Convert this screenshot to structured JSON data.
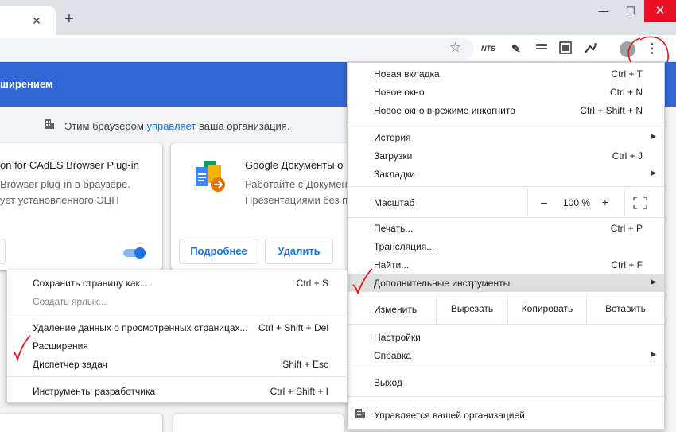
{
  "window": {
    "tab_close": "✕",
    "new_tab": "+",
    "minimize": "—",
    "maximize": "☐",
    "close": "✕"
  },
  "toolbar": {
    "ext_nts": "NTS"
  },
  "page": {
    "header_title": "ширением",
    "managed_prefix": "Этим браузером ",
    "managed_link": "управляет",
    "managed_suffix": " ваша организация.",
    "card1": {
      "title": "on for CAdES Browser Plug-in",
      "description": "Browser plug-in в браузере.\nует установленного ЭЦП",
      "toggle_enabled": true
    },
    "card2": {
      "title": "Google Документы о",
      "description": "Работайте с Докумен\nПрезентациями без п",
      "details_button": "Подробнее",
      "remove_button": "Удалить"
    }
  },
  "menu": {
    "new_tab": {
      "label": "Новая вкладка",
      "shortcut": "Ctrl + T"
    },
    "new_window": {
      "label": "Новое окно",
      "shortcut": "Ctrl + N"
    },
    "incognito": {
      "label": "Новое окно в режиме инкогнито",
      "shortcut": "Ctrl + Shift + N"
    },
    "history": {
      "label": "История"
    },
    "downloads": {
      "label": "Загрузки",
      "shortcut": "Ctrl + J"
    },
    "bookmarks": {
      "label": "Закладки"
    },
    "zoom": {
      "label": "Масштаб",
      "minus": "–",
      "value": "100 %",
      "plus": "+"
    },
    "print": {
      "label": "Печать...",
      "shortcut": "Ctrl + P"
    },
    "cast": {
      "label": "Трансляция..."
    },
    "find": {
      "label": "Найти...",
      "shortcut": "Ctrl + F"
    },
    "more_tools": {
      "label": "Дополнительные инструменты"
    },
    "edit": {
      "label": "Изменить",
      "cut": "Вырезать",
      "copy": "Копировать",
      "paste": "Вставить"
    },
    "settings": {
      "label": "Настройки"
    },
    "help": {
      "label": "Справка"
    },
    "exit": {
      "label": "Выход"
    },
    "managed": {
      "label": "Управляется вашей организацией"
    },
    "submenu_arrow": "▶"
  },
  "submenu": {
    "save_page": {
      "label": "Сохранить страницу как...",
      "shortcut": "Ctrl + S"
    },
    "create_shortcut": {
      "label": "Создать ярлык..."
    },
    "clear_data": {
      "label": "Удаление данных о просмотренных страницах...",
      "shortcut": "Ctrl + Shift + Del"
    },
    "extensions": {
      "label": "Расширения"
    },
    "task_manager": {
      "label": "Диспетчер задач",
      "shortcut": "Shift + Esc"
    },
    "dev_tools": {
      "label": "Инструменты разработчика",
      "shortcut": "Ctrl + Shift + I"
    }
  },
  "colors": {
    "accent": "#1a73e8",
    "header": "#3367d6",
    "annotation": "#e8141c"
  }
}
